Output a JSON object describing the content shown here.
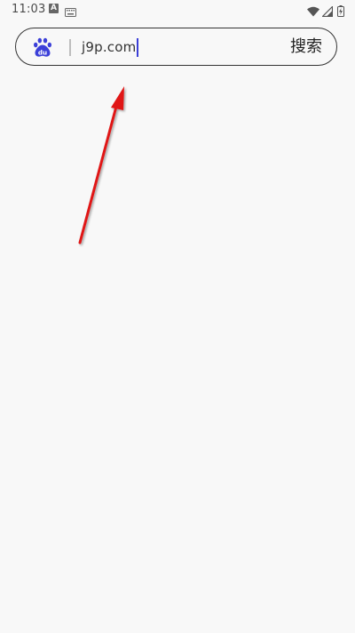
{
  "status_bar": {
    "time": "11:03",
    "notification_letter": "A",
    "icons": [
      "notification-a-icon",
      "keyboard-icon",
      "wifi-icon",
      "signal-icon",
      "battery-icon"
    ]
  },
  "search": {
    "logo_text": "du",
    "input_value": "j9p.com",
    "button_label": "搜索"
  },
  "colors": {
    "background": "#f8f8f8",
    "logo_blue": "#3b3fd8",
    "caret": "#3b3fd8",
    "arrow_red": "#e01818"
  }
}
